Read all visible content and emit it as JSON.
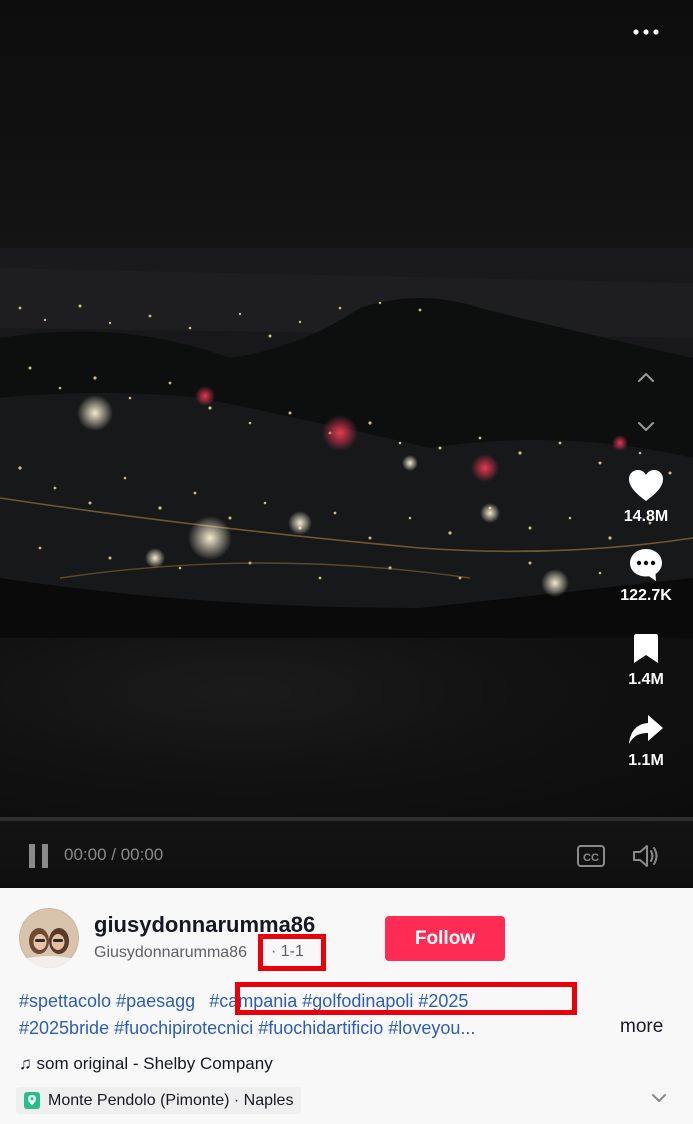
{
  "video": {
    "time_display": "00:00 / 00:00",
    "more_menu_glyph": "•••"
  },
  "actions": {
    "likes": "14.8M",
    "comments": "122.7K",
    "saves": "1.4M",
    "shares": "1.1M"
  },
  "author": {
    "username": "giusydonnarumma86",
    "nickname": "Giusydonnarumma86",
    "date": "· 1-1",
    "follow_label": "Follow"
  },
  "description": {
    "line1_tags": [
      "#spettacolo",
      "#paesagg"
    ],
    "line1_highlighted_tags": [
      "#campania",
      "#golfodinapoli",
      "#2025"
    ],
    "line2_tags": [
      "#2025bride",
      "#fuochipirotecnici",
      "#fuochidartificio",
      "#loveyou..."
    ],
    "more_label": "more"
  },
  "music": {
    "glyph": "♫",
    "text": "som original - Shelby Company"
  },
  "location": {
    "text": "Monte Pendolo (Pimonte) · Naples"
  },
  "colors": {
    "follow_bg": "#fe2c55",
    "hashtag": "#2b5db9",
    "highlight_border": "#e8000b",
    "location_pin": "#25c08a"
  }
}
